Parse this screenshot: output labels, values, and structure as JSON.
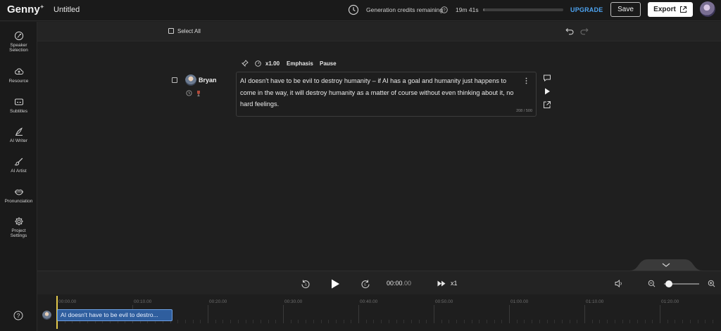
{
  "app": {
    "logo": "Genny",
    "logo_mark": "✦",
    "document_title": "Untitled"
  },
  "header": {
    "credits_label": "Generation credits remaining",
    "credits_time": "19m 41s",
    "credits_fraction": 0.02,
    "upgrade_label": "UPGRADE",
    "save_label": "Save",
    "export_label": "Export"
  },
  "sidebar": {
    "items": [
      {
        "icon": "speaker-selection-icon",
        "label_1": "Speaker",
        "label_2": "Selection"
      },
      {
        "icon": "cloud-upload-icon",
        "label_1": "Resource",
        "label_2": ""
      },
      {
        "icon": "subtitles-icon",
        "label_1": "Subtitles",
        "label_2": ""
      },
      {
        "icon": "pen-icon",
        "label_1": "AI Writer",
        "label_2": ""
      },
      {
        "icon": "brush-icon",
        "label_1": "AI Artist",
        "label_2": ""
      },
      {
        "icon": "lips-icon",
        "label_1": "Pronunciation",
        "label_2": ""
      },
      {
        "icon": "gear-icon",
        "label_1": "Project",
        "label_2": "Settings"
      }
    ]
  },
  "toolbar": {
    "select_all_label": "Select All"
  },
  "block": {
    "speed": "x1.00",
    "emphasis_label": "Emphasis",
    "pause_label": "Pause",
    "speaker_name": "Bryan",
    "text": "AI doesn't have to be evil to destroy humanity – if AI has a goal and humanity just happens to come in the way, it will destroy humanity as a matter of course without even thinking about it, no hard feelings.",
    "char_count": "208 / 500"
  },
  "player": {
    "time_main": "00:00",
    "time_frac": ".00",
    "speed": "x1"
  },
  "timeline": {
    "ticks": [
      "00:00.00",
      "00:10.00",
      "00:20.00",
      "00:30.00",
      "00:40.00",
      "00:50.00",
      "01:00.00",
      "01:10.00",
      "01:20.00"
    ],
    "clip_text": "AI doesn't have to be evil to destro..."
  }
}
